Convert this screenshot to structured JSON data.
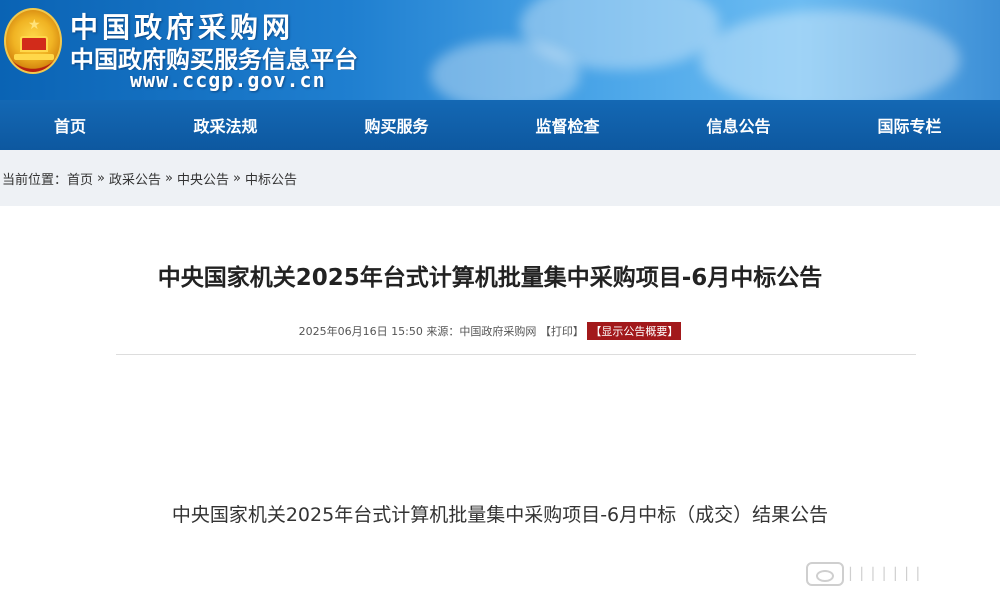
{
  "header": {
    "site_name": "中国政府采购网",
    "site_subtitle": "中国政府购买服务信息平台",
    "site_url": "www.ccgp.gov.cn"
  },
  "nav": {
    "items": [
      {
        "label": "首页"
      },
      {
        "label": "政采法规"
      },
      {
        "label": "购买服务"
      },
      {
        "label": "监督检查"
      },
      {
        "label": "信息公告"
      },
      {
        "label": "国际专栏"
      }
    ]
  },
  "breadcrumb": {
    "prefix": "当前位置：",
    "items": [
      "首页",
      "政采公告",
      "中央公告",
      "中标公告"
    ],
    "separator": "»"
  },
  "article": {
    "title": "中央国家机关2025年台式计算机批量集中采购项目-6月中标公告",
    "datetime": "2025年06月16日 15:50",
    "source_label": "来源：",
    "source": "中国政府采购网",
    "print_label": "【打印】",
    "summary_button": "【显示公告概要】",
    "subtitle": "中央国家机关2025年台式计算机批量集中采购项目-6月中标（成交）结果公告"
  },
  "colors": {
    "nav_bg": "#0d58a0",
    "badge_bg": "#a2191b",
    "breadcrumb_bg": "#eef1f5"
  }
}
